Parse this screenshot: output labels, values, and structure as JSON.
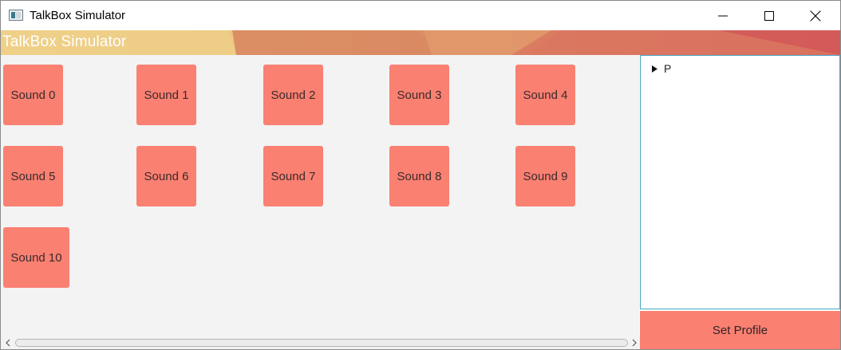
{
  "window": {
    "title": "TalkBox Simulator"
  },
  "banner": {
    "title": "TalkBox Simulator"
  },
  "sounds": [
    {
      "label": "Sound 0"
    },
    {
      "label": "Sound 1"
    },
    {
      "label": "Sound 2"
    },
    {
      "label": "Sound 3"
    },
    {
      "label": "Sound 4"
    },
    {
      "label": "Sound 5"
    },
    {
      "label": "Sound 6"
    },
    {
      "label": "Sound 7"
    },
    {
      "label": "Sound 8"
    },
    {
      "label": "Sound 9"
    },
    {
      "label": "Sound 10"
    }
  ],
  "tree": {
    "items": [
      {
        "label": "P",
        "icon": "triangle-right-icon"
      }
    ]
  },
  "profile_button": {
    "label": "Set Profile"
  },
  "colors": {
    "sound_button": "#fa8072",
    "content_bg": "#f3f3f3",
    "tree_border": "#4aa3c7"
  }
}
